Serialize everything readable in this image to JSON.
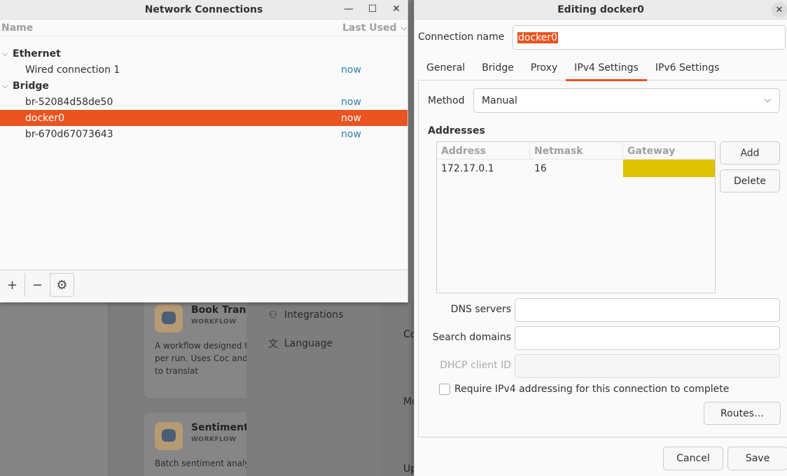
{
  "background": {
    "cards": [
      {
        "title": "Book Transl",
        "tag": "WORKFLOW",
        "desc": "A workflow designed to tokens per run. Uses Coc and Iteration to translat"
      },
      {
        "title": "Sentiment A",
        "tag": "WORKFLOW",
        "desc": "Batch sentiment analysis"
      }
    ],
    "menu": [
      {
        "label": "Integrations",
        "icon": "puzzle-icon"
      },
      {
        "label": "Language",
        "icon": "translate-icon"
      }
    ],
    "right_labels": [
      "Co",
      "Mo",
      "Up"
    ]
  },
  "network_connections": {
    "title": "Network Connections",
    "col_name": "Name",
    "col_last_used": "Last Used",
    "groups": [
      {
        "label": "Ethernet",
        "items": [
          {
            "name": "Wired connection 1",
            "last_used": "now"
          }
        ]
      },
      {
        "label": "Bridge",
        "items": [
          {
            "name": "br-52084d58de50",
            "last_used": "now"
          },
          {
            "name": "docker0",
            "last_used": "now",
            "selected": true
          },
          {
            "name": "br-670d67073643",
            "last_used": "now"
          }
        ]
      }
    ],
    "toolbar": {
      "add": "+",
      "remove": "−"
    }
  },
  "editor": {
    "title": "Editing docker0",
    "connection_name_label": "Connection name",
    "connection_name_value": "docker0",
    "tabs": [
      {
        "label": "General"
      },
      {
        "label": "Bridge"
      },
      {
        "label": "Proxy"
      },
      {
        "label": "IPv4 Settings",
        "active": true
      },
      {
        "label": "IPv6 Settings"
      }
    ],
    "method_label": "Method",
    "method_value": "Manual",
    "addresses_heading": "Addresses",
    "address_cols": [
      "Address",
      "Netmask",
      "Gateway"
    ],
    "addresses": [
      {
        "address": "172.17.0.1",
        "netmask": "16",
        "gateway": ""
      }
    ],
    "add_label": "Add",
    "delete_label": "Delete",
    "dns_label": "DNS servers",
    "search_label": "Search domains",
    "dhcp_label": "DHCP client ID",
    "require_label": "Require IPv4 addressing for this connection to complete",
    "routes_label": "Routes…",
    "cancel_label": "Cancel",
    "save_label": "Save",
    "accent": "#e95420",
    "gateway_highlight": "#ddc300"
  }
}
